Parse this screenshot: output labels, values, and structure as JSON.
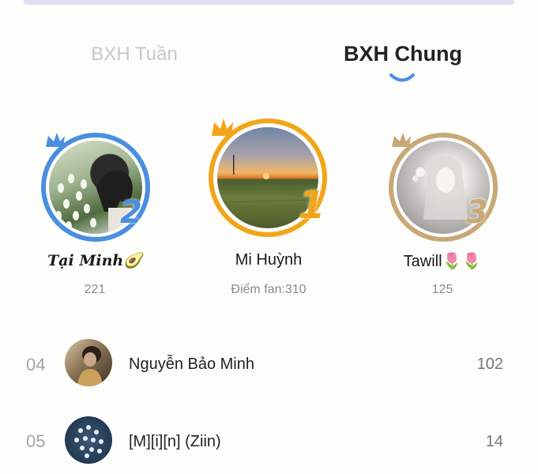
{
  "tabs": {
    "weekly": "BXH Tuần",
    "general": "BXH Chung"
  },
  "podium": [
    {
      "rank": "2",
      "name": "Tại Minh🥑",
      "score": "221",
      "ring_color": "#4a8fdf"
    },
    {
      "rank": "1",
      "name": "Mi Huỳnh",
      "score": "Điểm fan:310",
      "ring_color": "#f2a518"
    },
    {
      "rank": "3",
      "name": "Tawill🌷🌷",
      "score": "125",
      "ring_color": "#c9a877"
    }
  ],
  "list": [
    {
      "rank": "04",
      "name": "Nguyễn Bảo Minh",
      "score": "102"
    },
    {
      "rank": "05",
      "name": "[M][i][n] (Ziin)",
      "score": "14"
    }
  ]
}
